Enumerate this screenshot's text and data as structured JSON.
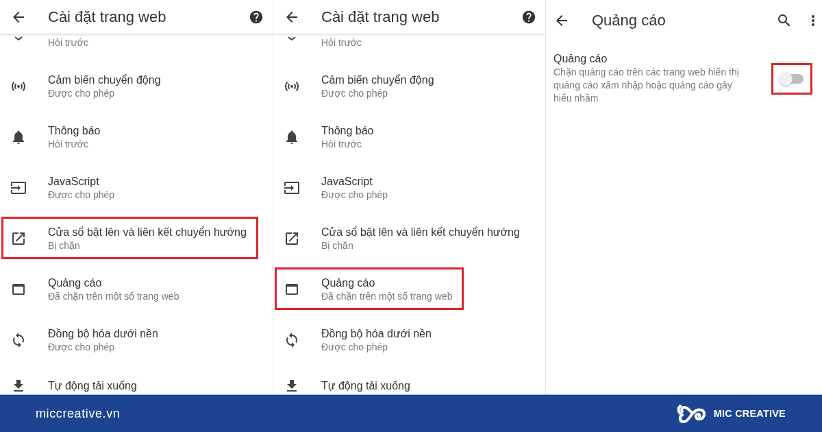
{
  "panels": [
    {
      "header": {
        "title": "Cài đặt trang web"
      },
      "items": [
        {
          "subtitle": "Hỏi trước",
          "highlighted": false
        },
        {
          "title": "Cảm biến chuyển động",
          "subtitle": "Được cho phép",
          "highlighted": false
        },
        {
          "title": "Thông báo",
          "subtitle": "Hỏi trước",
          "highlighted": false
        },
        {
          "title": "JavaScript",
          "subtitle": "Được cho phép",
          "highlighted": false
        },
        {
          "title": "Cửa sổ bật lên và liên kết chuyển hướng",
          "subtitle": "Bị chặn",
          "highlighted": true
        },
        {
          "title": "Quảng cáo",
          "subtitle": "Đã chặn trên một số trang web",
          "highlighted": false
        },
        {
          "title": "Đồng bộ hóa dưới nền",
          "subtitle": "Được cho phép",
          "highlighted": false
        },
        {
          "title": "Tự động tải xuống",
          "highlighted": false
        }
      ]
    },
    {
      "header": {
        "title": "Cài đặt trang web"
      },
      "items": [
        {
          "subtitle": "Hỏi trước",
          "highlighted": false
        },
        {
          "title": "Cảm biến chuyển động",
          "subtitle": "Được cho phép",
          "highlighted": false
        },
        {
          "title": "Thông báo",
          "subtitle": "Hỏi trước",
          "highlighted": false
        },
        {
          "title": "JavaScript",
          "subtitle": "Được cho phép",
          "highlighted": false
        },
        {
          "title": "Cửa sổ bật lên và liên kết chuyển hướng",
          "subtitle": "Bị chặn",
          "highlighted": false
        },
        {
          "title": "Quảng cáo",
          "subtitle": "Đã chặn trên một số trang web",
          "highlighted": true
        },
        {
          "title": "Đồng bộ hóa dưới nền",
          "subtitle": "Được cho phép",
          "highlighted": false
        },
        {
          "title": "Tự động tải xuống",
          "highlighted": false
        }
      ]
    }
  ],
  "ad_settings": {
    "header": {
      "title": "Quảng cáo"
    },
    "setting": {
      "title": "Quảng cáo",
      "description": "Chặn quảng cáo trên các trang web hiển thị quảng cáo xâm nhập hoặc quảng cáo gây hiểu nhầm",
      "toggle": {
        "on": false,
        "highlighted": true
      }
    }
  },
  "brand_bar": {
    "site": "miccreative.vn",
    "logo_text": "MIC CREATIVE"
  }
}
